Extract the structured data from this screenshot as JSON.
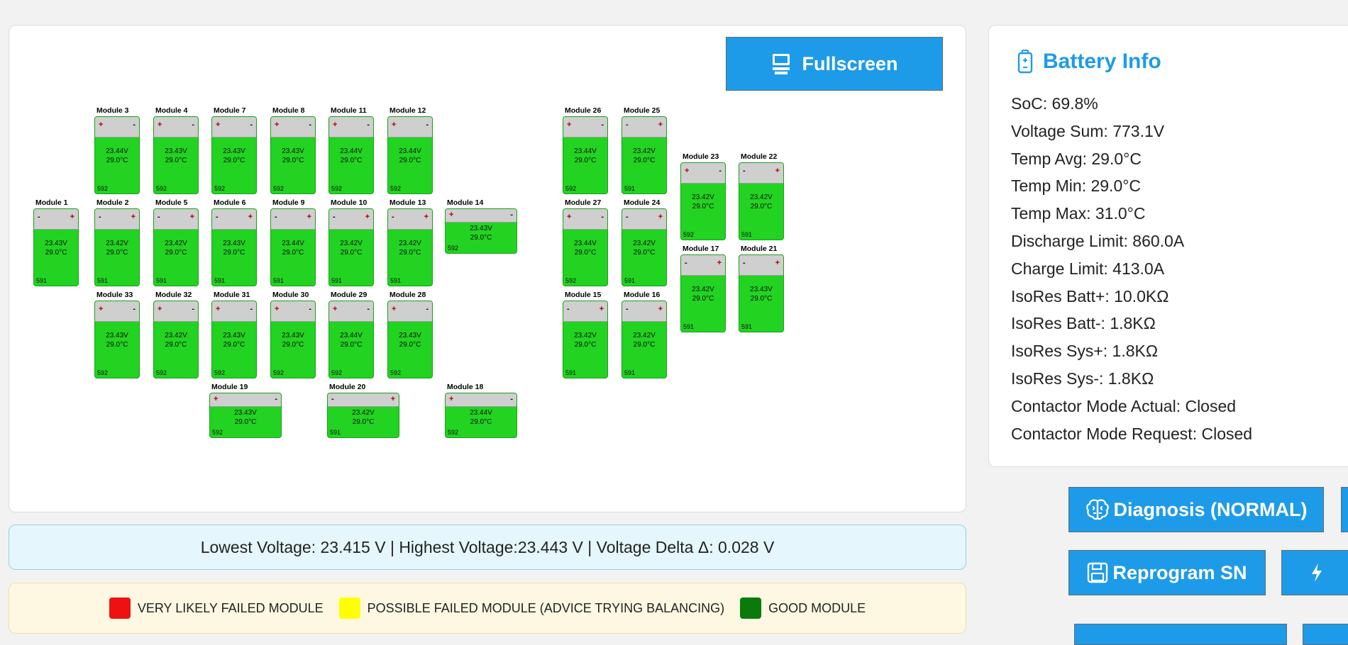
{
  "toolbar": {
    "fullscreen_label": "Fullscreen"
  },
  "modules": [
    {
      "name": "Module 3",
      "voltage": "23.44V",
      "temp": "29.0°C",
      "sn": "592",
      "left": "+",
      "right": "-"
    },
    {
      "name": "Module 4",
      "voltage": "23.43V",
      "temp": "29.0°C",
      "sn": "592",
      "left": "+",
      "right": "-"
    },
    {
      "name": "Module 7",
      "voltage": "23.43V",
      "temp": "29.0°C",
      "sn": "592",
      "left": "+",
      "right": "-"
    },
    {
      "name": "Module 8",
      "voltage": "23.43V",
      "temp": "29.0°C",
      "sn": "592",
      "left": "+",
      "right": "-"
    },
    {
      "name": "Module 11",
      "voltage": "23.44V",
      "temp": "29.0°C",
      "sn": "592",
      "left": "+",
      "right": "-"
    },
    {
      "name": "Module 12",
      "voltage": "23.44V",
      "temp": "29.0°C",
      "sn": "592",
      "left": "+",
      "right": "-"
    },
    {
      "name": "Module 26",
      "voltage": "23.44V",
      "temp": "29.0°C",
      "sn": "592",
      "left": "+",
      "right": "-"
    },
    {
      "name": "Module 25",
      "voltage": "23.42V",
      "temp": "29.0°C",
      "sn": "591",
      "left": "-",
      "right": "+"
    },
    {
      "name": "Module 23",
      "voltage": "23.42V",
      "temp": "29.0°C",
      "sn": "592",
      "left": "+",
      "right": "-"
    },
    {
      "name": "Module 22",
      "voltage": "23.42V",
      "temp": "29.0°C",
      "sn": "591",
      "left": "-",
      "right": "+"
    },
    {
      "name": "Module 1",
      "voltage": "23.43V",
      "temp": "29.0°C",
      "sn": "591",
      "left": "-",
      "right": "+"
    },
    {
      "name": "Module 2",
      "voltage": "23.42V",
      "temp": "29.0°C",
      "sn": "591",
      "left": "-",
      "right": "+"
    },
    {
      "name": "Module 5",
      "voltage": "23.42V",
      "temp": "29.0°C",
      "sn": "591",
      "left": "-",
      "right": "+"
    },
    {
      "name": "Module 6",
      "voltage": "23.43V",
      "temp": "29.0°C",
      "sn": "591",
      "left": "-",
      "right": "+"
    },
    {
      "name": "Module 9",
      "voltage": "23.44V",
      "temp": "29.0°C",
      "sn": "591",
      "left": "-",
      "right": "+"
    },
    {
      "name": "Module 10",
      "voltage": "23.42V",
      "temp": "29.0°C",
      "sn": "591",
      "left": "-",
      "right": "+"
    },
    {
      "name": "Module 13",
      "voltage": "23.42V",
      "temp": "29.0°C",
      "sn": "591",
      "left": "-",
      "right": "+"
    },
    {
      "name": "Module 14",
      "voltage": "23.43V",
      "temp": "29.0°C",
      "sn": "592",
      "left": "+",
      "right": "-"
    },
    {
      "name": "Module 27",
      "voltage": "23.44V",
      "temp": "29.0°C",
      "sn": "592",
      "left": "+",
      "right": "-"
    },
    {
      "name": "Module 24",
      "voltage": "23.42V",
      "temp": "29.0°C",
      "sn": "591",
      "left": "-",
      "right": "+"
    },
    {
      "name": "Module 17",
      "voltage": "23.42V",
      "temp": "29.0°C",
      "sn": "591",
      "left": "-",
      "right": "+"
    },
    {
      "name": "Module 21",
      "voltage": "23.43V",
      "temp": "29.0°C",
      "sn": "591",
      "left": "-",
      "right": "+"
    },
    {
      "name": "Module 33",
      "voltage": "23.43V",
      "temp": "29.0°C",
      "sn": "592",
      "left": "+",
      "right": "-"
    },
    {
      "name": "Module 32",
      "voltage": "23.42V",
      "temp": "29.0°C",
      "sn": "592",
      "left": "+",
      "right": "-"
    },
    {
      "name": "Module 31",
      "voltage": "23.43V",
      "temp": "29.0°C",
      "sn": "592",
      "left": "+",
      "right": "-"
    },
    {
      "name": "Module 30",
      "voltage": "23.43V",
      "temp": "29.0°C",
      "sn": "592",
      "left": "+",
      "right": "-"
    },
    {
      "name": "Module 29",
      "voltage": "23.44V",
      "temp": "29.0°C",
      "sn": "592",
      "left": "+",
      "right": "-"
    },
    {
      "name": "Module 28",
      "voltage": "23.43V",
      "temp": "29.0°C",
      "sn": "592",
      "left": "+",
      "right": "-"
    },
    {
      "name": "Module 15",
      "voltage": "23.42V",
      "temp": "29.0°C",
      "sn": "591",
      "left": "-",
      "right": "+"
    },
    {
      "name": "Module 16",
      "voltage": "23.42V",
      "temp": "29.0°C",
      "sn": "591",
      "left": "-",
      "right": "+"
    },
    {
      "name": "Module 19",
      "voltage": "23.43V",
      "temp": "29.0°C",
      "sn": "592",
      "left": "+",
      "right": "-"
    },
    {
      "name": "Module 20",
      "voltage": "23.42V",
      "temp": "29.0°C",
      "sn": "591",
      "left": "-",
      "right": "+"
    },
    {
      "name": "Module 18",
      "voltage": "23.44V",
      "temp": "29.0°C",
      "sn": "592",
      "left": "+",
      "right": "-"
    }
  ],
  "voltage_summary": "Lowest Voltage: 23.415 V | Highest Voltage:23.443 V | Voltage Delta Δ: 0.028 V",
  "legend": [
    {
      "label": "VERY LIKELY FAILED MODULE",
      "color": "#ee1111"
    },
    {
      "label": "POSSIBLE FAILED MODULE (ADVICE TRYING BALANCING)",
      "color": "#ffff00"
    },
    {
      "label": "GOOD MODULE",
      "color": "#0a7a0a"
    }
  ],
  "battery_info": {
    "title": "Battery Info",
    "items": [
      "SoC: 69.8%",
      "Voltage Sum: 773.1V",
      "Temp Avg: 29.0°C",
      "Temp Min: 29.0°C",
      "Temp Max: 31.0°C",
      "Discharge Limit: 860.0A",
      "Charge Limit: 413.0A",
      "IsoRes Batt+: 10.0KΩ",
      "IsoRes Batt-: 1.8KΩ",
      "IsoRes Sys+: 1.8KΩ",
      "IsoRes Sys-: 1.8KΩ",
      "Contactor Mode Actual: Closed",
      "Contactor Mode Request: Closed"
    ]
  },
  "buttons": {
    "diagnosis": "Diagnosis (NORMAL)",
    "reprogram": "Reprogram SN"
  },
  "colors": {
    "accent": "#1e9be8",
    "module_good": "#22d322"
  }
}
